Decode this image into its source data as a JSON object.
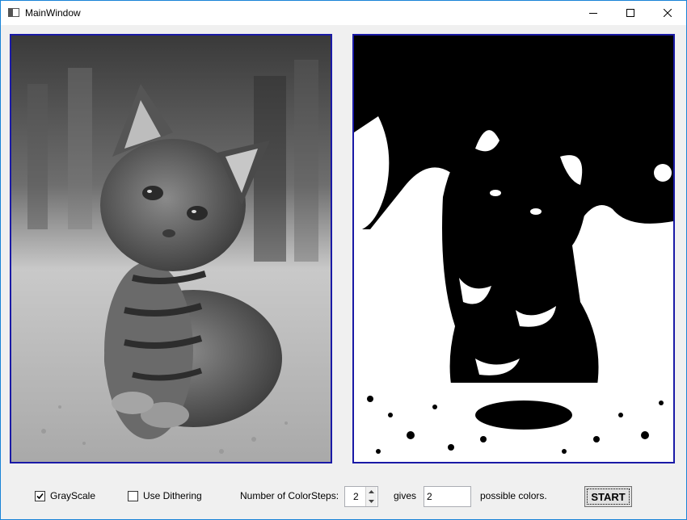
{
  "window": {
    "title": "MainWindow",
    "icons": {
      "app": "window-app-icon",
      "minimize": "minimize-icon",
      "maximize": "maximize-icon",
      "close": "close-icon"
    }
  },
  "images": {
    "source": {
      "description": "grayscale-kitten-photo"
    },
    "result": {
      "description": "two-tone-black-white-kitten"
    }
  },
  "controls": {
    "grayscale": {
      "label": "GrayScale",
      "checked": true
    },
    "dithering": {
      "label": "Use Dithering",
      "checked": false
    },
    "color_steps_label": "Number of ColorSteps:",
    "color_steps_value": "2",
    "gives_label": "gives",
    "possible_colors_value": "2",
    "possible_colors_label": "possible colors.",
    "start_label": "START"
  },
  "colors": {
    "panel_border": "#1a1aa6",
    "title_accent": "#1883d7"
  }
}
